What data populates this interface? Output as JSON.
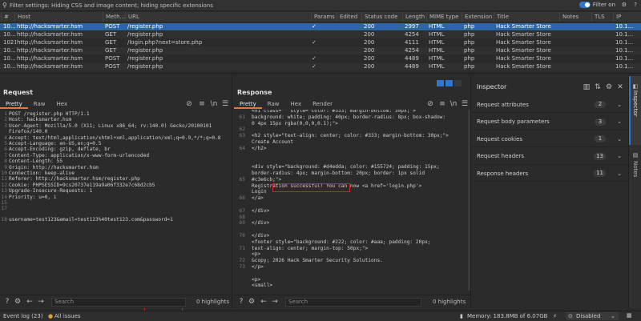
{
  "filter_bar": {
    "text": "Filter settings: Hiding CSS and image content; hiding specific extensions",
    "filter_on_label": "Filter on"
  },
  "history": {
    "columns": [
      "#",
      "Host",
      "Meth...",
      "URL",
      "Params",
      "Edited",
      "Status code",
      "Length",
      "MIME type",
      "Extension",
      "Title",
      "Notes",
      "TLS",
      "IP"
    ],
    "rows": [
      [
        "10...",
        "http://hacksmarter.hsm",
        "POST",
        "/register.php",
        "✓",
        "",
        "200",
        "2997",
        "HTML",
        "php",
        "Hack Smarter Store",
        "",
        "",
        "10.1..."
      ],
      [
        "10...",
        "http://hacksmarter.hsm",
        "GET",
        "/register.php",
        "",
        "",
        "200",
        "4254",
        "HTML",
        "php",
        "Hack Smarter Store",
        "",
        "",
        "10.1..."
      ],
      [
        "1021",
        "http://hacksmarter.hsm",
        "GET",
        "/login.php?next=store.php",
        "✓",
        "",
        "200",
        "4111",
        "HTML",
        "php",
        "Hack Smarter Store",
        "",
        "",
        "10.1..."
      ],
      [
        "10...",
        "http://hacksmarter.hsm",
        "GET",
        "/register.php",
        "",
        "",
        "200",
        "4254",
        "HTML",
        "php",
        "Hack Smarter Store",
        "",
        "",
        "10.1..."
      ],
      [
        "10...",
        "http://hacksmarter.hsm",
        "POST",
        "/register.php",
        "✓",
        "",
        "200",
        "4489",
        "HTML",
        "php",
        "Hack Smarter Store",
        "",
        "",
        "10.1..."
      ],
      [
        "10...",
        "http://hacksmarter.hsm",
        "POST",
        "/register.php",
        "✓",
        "",
        "200",
        "4489",
        "HTML",
        "php",
        "Hack Smarter Store",
        "",
        "",
        "10.1..."
      ]
    ]
  },
  "request": {
    "title": "Request",
    "tabs": [
      "Pretty",
      "Raw",
      "Hex"
    ],
    "lines": [
      "POST /register.php HTTP/1.1",
      "Host: hacksmarter.hsm",
      "User-Agent: Mozilla/5.0 (X11; Linux x86_64; rv:140.0) Gecko/20100101",
      "Firefox/140.0",
      "Accept: text/html,application/xhtml+xml,application/xml;q=0.9,*/*;q=0.8",
      "Accept-Language: en-US,en;q=0.5",
      "Accept-Encoding: gzip, deflate, br",
      "Content-Type: application/x-www-form-urlencoded",
      "Content-Length: 55",
      "Origin: http://hacksmarter.hsm",
      "Connection: keep-alive",
      "Referer: http://hacksmarter.hsm/register.php",
      "Cookie: PHPSESSID=9cs20737e119a9a06f332e7c68d2cb5",
      "Upgrade-Insecure-Requests: 1",
      "Priority: u=0, i",
      "",
      "",
      "username=test123&email=test123%40test123.com&password=1"
    ],
    "line_numbers": [
      "1",
      "2",
      "3",
      "",
      "4",
      "5",
      "6",
      "7",
      "8",
      "9",
      "10",
      "11",
      "12",
      "13",
      "14",
      "15",
      "17",
      "18"
    ],
    "search_placeholder": "Search",
    "highlights": "0 highlights"
  },
  "response": {
    "title": "Response",
    "tabs": [
      "Pretty",
      "Raw",
      "Hex",
      "Render"
    ],
    "lines": [
      "<h1 class=\"\" style=\"color: #333; margin-bottom: 30px;\">",
      "background: white; padding: 40px; border-radius: 8px; box-shadow:",
      "0 4px 15px rgba(0,0,0,0.1);\">",
      "",
      "<h2 style=\"text-align: center; color: #333; margin-bottom: 30px;\">",
      "  Create Account",
      "</h2>",
      "",
      "",
      "<div style=\"background: #d4edda; color: #155724; padding: 15px;",
      "border-radius: 4px; margin-bottom: 20px; border: 1px solid",
      "#c3e6cb;\">",
      "  Registration successful! You can now <a href='login.php'>",
      "  Login",
      "  </a>",
      "",
      "</div>",
      "",
      "</div>",
      "",
      "</div>",
      "<footer style=\"background: #222; color: #aaa; padding: 20px;",
      "text-align: center; margin-top: 50px;\">",
      "  <p>",
      "    &copy; 2026 Hack Smarter Security Solutions.",
      "  </p>",
      "",
      "  <p>",
      "    <small>"
    ],
    "line_numbers": [
      "",
      "61",
      "",
      "62",
      "63",
      "",
      "64",
      "",
      "",
      "",
      "",
      "65",
      "",
      "",
      "66",
      "",
      "67",
      "68",
      "69",
      "",
      "70",
      "",
      "71",
      "",
      "72",
      "73",
      "",
      ""
    ],
    "search_placeholder": "Search",
    "highlights": "0 highlights"
  },
  "inspector": {
    "title": "Inspector",
    "sections": [
      {
        "label": "Request attributes",
        "count": "2"
      },
      {
        "label": "Request body parameters",
        "count": "3"
      },
      {
        "label": "Request cookies",
        "count": "1"
      },
      {
        "label": "Request headers",
        "count": "13"
      },
      {
        "label": "Response headers",
        "count": "11"
      }
    ]
  },
  "side_tabs": {
    "inspector": "Inspector",
    "notes": "Notes"
  },
  "status_bar": {
    "event_log": "Event log (23)",
    "all_issues": "All issues",
    "memory": "Memory: 183.8MB of 6.07GB",
    "disabled": "Disabled"
  },
  "colors": {
    "selected_row": "#2f65a7",
    "accent": "#e07a3b",
    "highlight_box": "#e01b24",
    "toggle_on": "#2f76d1"
  }
}
